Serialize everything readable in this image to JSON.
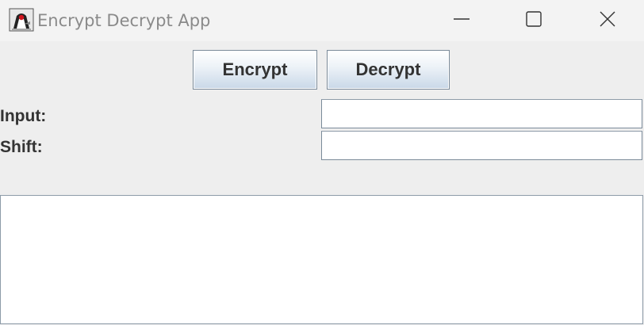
{
  "window": {
    "title": "Encrypt Decrypt App",
    "icon": "java-duke-icon",
    "controls": {
      "minimize_icon": "minimize-icon",
      "maximize_icon": "maximize-icon",
      "close_icon": "close-icon"
    }
  },
  "toolbar": {
    "encrypt_label": "Encrypt",
    "decrypt_label": "Decrypt"
  },
  "form": {
    "input_label": "Input:",
    "input_value": "",
    "shift_label": "Shift:",
    "shift_value": ""
  },
  "output": {
    "value": ""
  },
  "colors": {
    "window_bg": "#eeeeee",
    "titlebar_bg": "#f3f3f3",
    "title_text": "#8a8a8a",
    "label_text": "#333333",
    "field_border": "#7a8a99"
  }
}
